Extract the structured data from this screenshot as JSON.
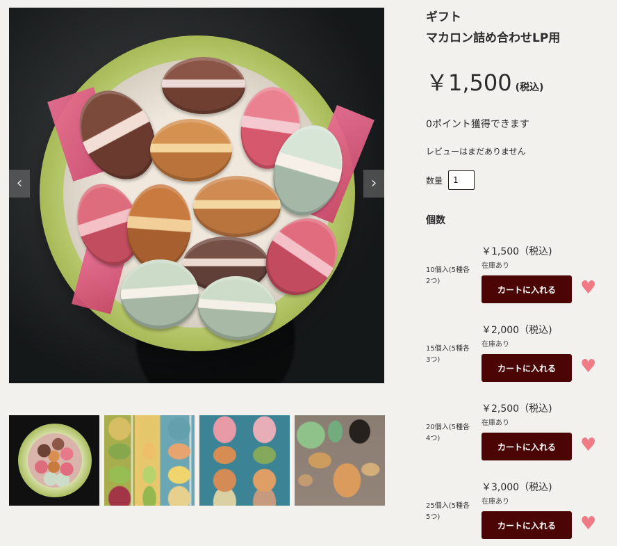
{
  "product": {
    "category": "ギフト",
    "title": "マカロン詰め合わせLP用",
    "price": "￥1,500",
    "tax_label": "(税込)",
    "points_text": "0ポイント獲得できます",
    "review_text": "レビューはまだありません",
    "quantity_label": "数量",
    "quantity_value": "1",
    "variants_heading": "個数"
  },
  "gallery": {
    "prev_icon": "chevron-left-icon",
    "next_icon": "chevron-right-icon",
    "prev_symbol": "‹",
    "next_symbol": "›"
  },
  "variants": [
    {
      "name": "10個入(5種各2つ)",
      "price": "￥1,500（税込)",
      "stock": "在庫あり",
      "button": "カートに入れる",
      "favorite_icon": "heart-icon",
      "symbol": "♥"
    },
    {
      "name": "15個入(5種各3つ)",
      "price": "￥2,000（税込)",
      "stock": "在庫あり",
      "button": "カートに入れる",
      "favorite_icon": "heart-icon",
      "symbol": "♥"
    },
    {
      "name": "20個入(5種各4つ)",
      "price": "￥2,500（税込)",
      "stock": "在庫あり",
      "button": "カートに入れる",
      "favorite_icon": "heart-icon",
      "symbol": "♥"
    },
    {
      "name": "25個入(5種各5つ)",
      "price": "￥3,000（税込)",
      "stock": "在庫あり",
      "button": "カートに入れる",
      "favorite_icon": "heart-icon",
      "symbol": "♥"
    }
  ],
  "colors": {
    "background": "#f3f1ee",
    "cart_button": "#4b0505",
    "favorite": "#f07b86"
  }
}
